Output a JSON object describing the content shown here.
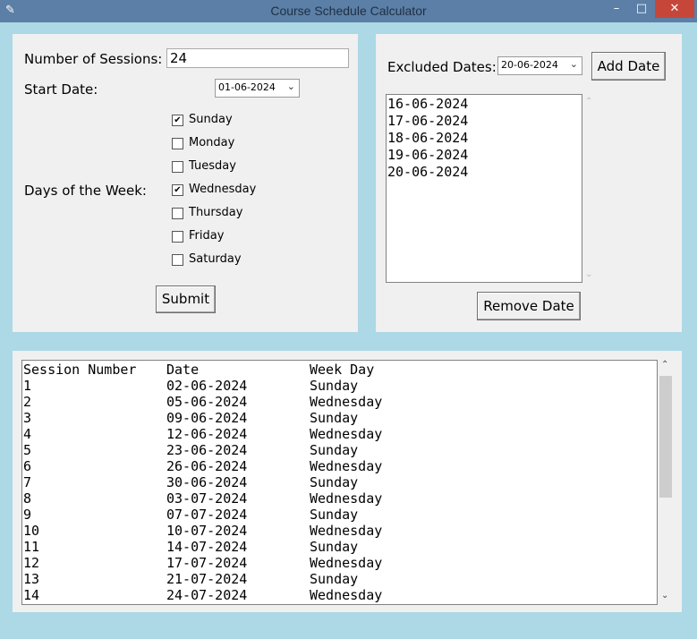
{
  "window": {
    "title": "Course Schedule Calculator",
    "minimize_glyph": "–",
    "maximize_glyph": "□",
    "close_glyph": "✕",
    "icon": "feather-icon"
  },
  "form": {
    "sessions_label": "Number of Sessions:",
    "sessions_value": "24",
    "start_label": "Start Date:",
    "start_value": "01-06-2024",
    "days_label": "Days of the Week:",
    "days": [
      {
        "label": "Sunday",
        "checked": true
      },
      {
        "label": "Monday",
        "checked": false
      },
      {
        "label": "Tuesday",
        "checked": false
      },
      {
        "label": "Wednesday",
        "checked": true
      },
      {
        "label": "Thursday",
        "checked": false
      },
      {
        "label": "Friday",
        "checked": false
      },
      {
        "label": "Saturday",
        "checked": false
      }
    ],
    "submit_label": "Submit"
  },
  "excluded": {
    "label": "Excluded Dates:",
    "date_value": "20-06-2024",
    "add_label": "Add Date",
    "dates": [
      "16-06-2024",
      "17-06-2024",
      "18-06-2024",
      "19-06-2024",
      "20-06-2024"
    ],
    "remove_label": "Remove Date"
  },
  "results": {
    "headers": [
      "Session Number",
      "Date",
      "Week Day"
    ],
    "rows": [
      [
        "1",
        "02-06-2024",
        "Sunday"
      ],
      [
        "2",
        "05-06-2024",
        "Wednesday"
      ],
      [
        "3",
        "09-06-2024",
        "Sunday"
      ],
      [
        "4",
        "12-06-2024",
        "Wednesday"
      ],
      [
        "5",
        "23-06-2024",
        "Sunday"
      ],
      [
        "6",
        "26-06-2024",
        "Wednesday"
      ],
      [
        "7",
        "30-06-2024",
        "Sunday"
      ],
      [
        "8",
        "03-07-2024",
        "Wednesday"
      ],
      [
        "9",
        "07-07-2024",
        "Sunday"
      ],
      [
        "10",
        "10-07-2024",
        "Wednesday"
      ],
      [
        "11",
        "14-07-2024",
        "Sunday"
      ],
      [
        "12",
        "17-07-2024",
        "Wednesday"
      ],
      [
        "13",
        "21-07-2024",
        "Sunday"
      ],
      [
        "14",
        "24-07-2024",
        "Wednesday"
      ]
    ]
  },
  "colors": {
    "background": "#add8e6",
    "titlebar": "#5b7fa6",
    "panel": "#f0f0f0",
    "close_button": "#c7463a"
  }
}
